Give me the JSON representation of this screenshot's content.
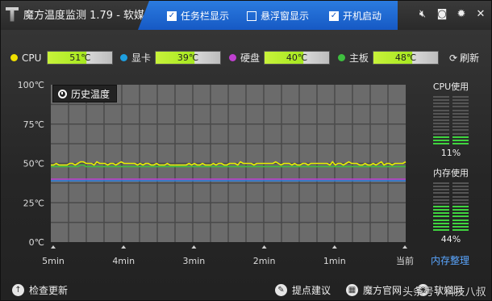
{
  "titlebar": {
    "title": "魔方温度监测 1.79 - 软媒",
    "options": [
      {
        "label": "任务栏显示",
        "checked": true
      },
      {
        "label": "悬浮窗显示",
        "checked": false
      },
      {
        "label": "开机启动",
        "checked": true
      }
    ],
    "controls": [
      "speaker-icon",
      "screenshot-icon",
      "settings-icon",
      "close-icon"
    ]
  },
  "temps": {
    "items": [
      {
        "name": "CPU",
        "value": "51℃",
        "color": "#f0e000"
      },
      {
        "name": "显卡",
        "value": "39℃",
        "color": "#1e9fe0"
      },
      {
        "name": "硬盘",
        "value": "40℃",
        "color": "#c040d0"
      },
      {
        "name": "主板",
        "value": "48℃",
        "color": "#3fbf3f"
      }
    ],
    "refresh_label": "刷新"
  },
  "chart": {
    "history_label": "历史温度"
  },
  "chart_data": {
    "type": "line",
    "title": "历史温度",
    "x_tick_labels": [
      "5min",
      "4min",
      "3min",
      "2min",
      "1min",
      "当前"
    ],
    "y_tick_labels": [
      "100℃",
      "75℃",
      "50℃",
      "25℃",
      "0℃"
    ],
    "ylim": [
      0,
      100
    ],
    "series": [
      {
        "name": "CPU",
        "color": "#e8f000",
        "values": [
          49,
          49,
          50,
          49,
          49,
          49,
          49,
          50,
          50,
          49,
          50,
          51,
          51,
          50,
          50,
          50,
          49,
          51,
          50,
          50,
          50,
          49,
          50,
          50,
          49,
          50,
          51,
          50,
          50,
          50,
          50,
          50,
          49,
          50,
          49,
          50,
          50,
          49,
          49,
          50,
          49,
          49,
          49,
          50,
          49,
          49,
          49,
          49,
          49,
          49,
          49,
          50,
          49,
          50,
          49,
          49,
          50,
          49,
          49,
          49,
          50,
          49,
          50,
          50,
          49,
          49,
          50,
          50,
          50,
          49,
          51,
          50,
          50,
          50,
          50,
          49,
          50,
          50,
          50,
          50,
          50,
          50,
          50,
          51,
          50,
          49,
          50,
          50,
          50,
          49,
          50,
          49,
          49,
          50,
          50,
          49,
          50,
          50,
          50,
          50,
          50,
          50,
          50,
          49,
          51,
          49,
          50,
          50,
          49,
          50,
          51,
          50,
          50,
          50,
          49,
          49,
          50,
          49,
          49,
          50,
          49,
          50,
          51,
          49,
          50,
          50,
          49,
          50,
          50,
          50,
          50,
          51
        ]
      },
      {
        "name": "主板",
        "color": "#3fbf3f",
        "values": [
          48,
          48,
          48,
          48,
          48,
          48,
          48,
          48,
          48,
          48,
          48,
          49,
          49,
          48,
          48,
          48,
          48,
          48,
          48,
          48,
          48,
          48,
          48,
          48,
          48,
          48,
          48,
          48,
          48,
          48,
          48,
          48,
          48,
          48,
          48,
          48,
          48,
          48,
          48,
          48,
          48,
          48,
          48,
          48,
          48,
          48,
          48,
          48,
          48,
          48,
          48,
          48,
          48,
          48,
          48,
          48,
          48,
          48,
          48,
          48,
          48,
          48,
          48,
          48,
          48,
          48,
          48,
          48,
          48,
          48,
          48,
          48,
          48,
          48,
          48,
          48,
          48,
          48,
          48,
          48,
          48,
          48,
          48,
          48,
          48,
          48,
          48,
          48,
          48,
          48,
          48,
          48,
          48,
          48,
          48,
          48,
          48,
          48,
          48,
          48,
          48,
          48,
          48,
          48,
          48,
          48,
          48,
          48,
          48,
          48,
          48,
          48,
          48,
          48,
          48,
          48,
          48,
          48,
          48,
          48,
          48,
          48,
          48,
          48,
          48,
          48,
          48,
          48,
          48,
          48,
          48,
          48
        ]
      },
      {
        "name": "硬盘",
        "color": "#c040d0",
        "values": [
          40,
          40,
          40,
          40,
          40,
          40,
          40,
          40,
          40,
          40,
          40,
          40,
          40,
          40,
          40,
          40,
          40,
          40,
          40,
          40,
          40,
          40,
          40,
          40,
          40,
          40,
          40,
          40,
          40,
          40,
          40,
          40,
          40,
          40,
          40,
          40,
          40,
          40,
          40,
          40,
          40,
          40,
          40,
          40,
          40,
          40,
          40,
          40,
          40,
          40,
          40,
          40,
          40,
          40,
          40,
          40,
          40,
          40,
          40,
          40,
          40,
          40,
          40,
          40,
          40,
          40,
          40,
          40,
          40,
          40,
          40,
          40,
          40,
          40,
          40,
          40,
          40,
          40,
          40,
          40,
          40,
          40,
          40,
          40,
          40,
          40,
          40,
          40,
          40,
          40,
          40,
          40,
          40,
          40,
          40,
          40,
          40,
          40,
          40,
          40,
          40,
          40,
          40,
          40,
          40,
          40,
          40,
          40,
          40,
          40,
          40,
          40,
          40,
          40,
          40,
          40,
          40,
          40,
          40,
          40,
          40,
          40,
          40,
          40,
          40,
          40,
          40,
          40,
          40,
          40,
          40,
          40
        ]
      },
      {
        "name": "显卡",
        "color": "#2a7fe0",
        "values": [
          39,
          39,
          39,
          39,
          39,
          39,
          39,
          39,
          39,
          39,
          39,
          39,
          39,
          39,
          39,
          39,
          39,
          39,
          39,
          39,
          39,
          39,
          39,
          39,
          39,
          39,
          39,
          39,
          39,
          39,
          39,
          39,
          39,
          39,
          39,
          39,
          39,
          39,
          39,
          39,
          39,
          39,
          39,
          39,
          39,
          39,
          39,
          39,
          39,
          39,
          39,
          39,
          39,
          39,
          39,
          39,
          39,
          39,
          39,
          39,
          39,
          39,
          39,
          39,
          39,
          39,
          39,
          39,
          39,
          39,
          39,
          39,
          39,
          39,
          39,
          39,
          39,
          39,
          39,
          39,
          39,
          39,
          39,
          39,
          39,
          39,
          39,
          39,
          39,
          39,
          39,
          39,
          39,
          39,
          39,
          39,
          39,
          39,
          39,
          39,
          39,
          39,
          39,
          39,
          39,
          39,
          39,
          39,
          39,
          39,
          39,
          39,
          39,
          39,
          39,
          39,
          39,
          39,
          39,
          39,
          39,
          39,
          39,
          39,
          39,
          39,
          39,
          39,
          39,
          39,
          39,
          39
        ]
      }
    ],
    "grid": true
  },
  "usage": {
    "cpu_label": "CPU使用",
    "cpu_percent": "11%",
    "cpu_level": 0.11,
    "mem_label": "内存使用",
    "mem_percent": "44%",
    "mem_level": 0.44,
    "mem_clean_label": "内存整理"
  },
  "bottom": {
    "check_update": "检查更新",
    "feedback": "提点建议",
    "official": "魔方官网",
    "software": "软媒网",
    "watermark": "头条号 / 科技八叔"
  }
}
